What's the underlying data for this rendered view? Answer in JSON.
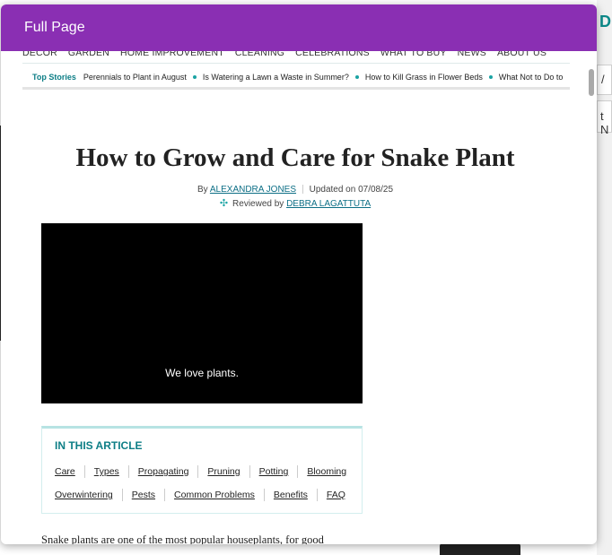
{
  "modal": {
    "title": "Full Page"
  },
  "background": {
    "right_box1_text": "/",
    "right_box2_text": "t N"
  },
  "nav": {
    "items": [
      "DECOR",
      "GARDEN",
      "HOME IMPROVEMENT",
      "CLEANING",
      "CELEBRATIONS",
      "WHAT TO BUY",
      "NEWS",
      "ABOUT US"
    ]
  },
  "top_stories": {
    "label": "Top Stories",
    "items": [
      "Perennials to Plant in August",
      "Is Watering a Lawn a Waste in Summer?",
      "How to Kill Grass in Flower Beds",
      "What Not to Do to"
    ]
  },
  "article": {
    "title": "How to Grow and Care for Snake Plant",
    "by_prefix": "By",
    "author": "ALEXANDRA JONES",
    "updated": "Updated on 07/08/25",
    "reviewed_prefix": "Reviewed by",
    "reviewer": "DEBRA LAGATTUTA",
    "video_caption": "We love plants.",
    "intro": "Snake plants are one of the most popular houseplants, for good"
  },
  "toc": {
    "title": "IN THIS ARTICLE",
    "row1": [
      "Care",
      "Types",
      "Propagating",
      "Pruning",
      "Potting",
      "Blooming"
    ],
    "row2": [
      "Overwintering",
      "Pests",
      "Common Problems",
      "Benefits",
      "FAQ"
    ]
  },
  "colors": {
    "modal_header": "#8a2fb3",
    "accent_teal": "#0d7e86"
  }
}
